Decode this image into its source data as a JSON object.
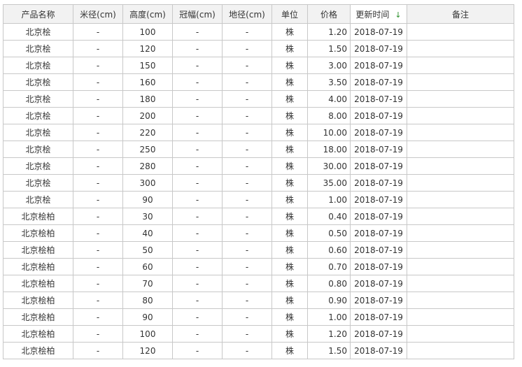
{
  "header": {
    "name": "产品名称",
    "diameter": "米径(cm)",
    "height": "高度(cm)",
    "crown": "冠幅(cm)",
    "ground": "地径(cm)",
    "unit": "单位",
    "price": "价格",
    "updated": "更新时间",
    "updated_arrow": "↓",
    "note": "备注"
  },
  "rows": [
    {
      "name": "北京桧",
      "diameter": "-",
      "height": "100",
      "crown": "-",
      "ground": "-",
      "unit": "株",
      "price": "1.20",
      "updated": "2018-07-19",
      "note": ""
    },
    {
      "name": "北京桧",
      "diameter": "-",
      "height": "120",
      "crown": "-",
      "ground": "-",
      "unit": "株",
      "price": "1.50",
      "updated": "2018-07-19",
      "note": ""
    },
    {
      "name": "北京桧",
      "diameter": "-",
      "height": "150",
      "crown": "-",
      "ground": "-",
      "unit": "株",
      "price": "3.00",
      "updated": "2018-07-19",
      "note": ""
    },
    {
      "name": "北京桧",
      "diameter": "-",
      "height": "160",
      "crown": "-",
      "ground": "-",
      "unit": "株",
      "price": "3.50",
      "updated": "2018-07-19",
      "note": ""
    },
    {
      "name": "北京桧",
      "diameter": "-",
      "height": "180",
      "crown": "-",
      "ground": "-",
      "unit": "株",
      "price": "4.00",
      "updated": "2018-07-19",
      "note": ""
    },
    {
      "name": "北京桧",
      "diameter": "-",
      "height": "200",
      "crown": "-",
      "ground": "-",
      "unit": "株",
      "price": "8.00",
      "updated": "2018-07-19",
      "note": ""
    },
    {
      "name": "北京桧",
      "diameter": "-",
      "height": "220",
      "crown": "-",
      "ground": "-",
      "unit": "株",
      "price": "10.00",
      "updated": "2018-07-19",
      "note": ""
    },
    {
      "name": "北京桧",
      "diameter": "-",
      "height": "250",
      "crown": "-",
      "ground": "-",
      "unit": "株",
      "price": "18.00",
      "updated": "2018-07-19",
      "note": ""
    },
    {
      "name": "北京桧",
      "diameter": "-",
      "height": "280",
      "crown": "-",
      "ground": "-",
      "unit": "株",
      "price": "30.00",
      "updated": "2018-07-19",
      "note": ""
    },
    {
      "name": "北京桧",
      "diameter": "-",
      "height": "300",
      "crown": "-",
      "ground": "-",
      "unit": "株",
      "price": "35.00",
      "updated": "2018-07-19",
      "note": ""
    },
    {
      "name": "北京桧",
      "diameter": "-",
      "height": "90",
      "crown": "-",
      "ground": "-",
      "unit": "株",
      "price": "1.00",
      "updated": "2018-07-19",
      "note": ""
    },
    {
      "name": "北京桧柏",
      "diameter": "-",
      "height": "30",
      "crown": "-",
      "ground": "-",
      "unit": "株",
      "price": "0.40",
      "updated": "2018-07-19",
      "note": ""
    },
    {
      "name": "北京桧柏",
      "diameter": "-",
      "height": "40",
      "crown": "-",
      "ground": "-",
      "unit": "株",
      "price": "0.50",
      "updated": "2018-07-19",
      "note": ""
    },
    {
      "name": "北京桧柏",
      "diameter": "-",
      "height": "50",
      "crown": "-",
      "ground": "-",
      "unit": "株",
      "price": "0.60",
      "updated": "2018-07-19",
      "note": ""
    },
    {
      "name": "北京桧柏",
      "diameter": "-",
      "height": "60",
      "crown": "-",
      "ground": "-",
      "unit": "株",
      "price": "0.70",
      "updated": "2018-07-19",
      "note": ""
    },
    {
      "name": "北京桧柏",
      "diameter": "-",
      "height": "70",
      "crown": "-",
      "ground": "-",
      "unit": "株",
      "price": "0.80",
      "updated": "2018-07-19",
      "note": ""
    },
    {
      "name": "北京桧柏",
      "diameter": "-",
      "height": "80",
      "crown": "-",
      "ground": "-",
      "unit": "株",
      "price": "0.90",
      "updated": "2018-07-19",
      "note": ""
    },
    {
      "name": "北京桧柏",
      "diameter": "-",
      "height": "90",
      "crown": "-",
      "ground": "-",
      "unit": "株",
      "price": "1.00",
      "updated": "2018-07-19",
      "note": ""
    },
    {
      "name": "北京桧柏",
      "diameter": "-",
      "height": "100",
      "crown": "-",
      "ground": "-",
      "unit": "株",
      "price": "1.20",
      "updated": "2018-07-19",
      "note": ""
    },
    {
      "name": "北京桧柏",
      "diameter": "-",
      "height": "120",
      "crown": "-",
      "ground": "-",
      "unit": "株",
      "price": "1.50",
      "updated": "2018-07-19",
      "note": ""
    }
  ],
  "colors": {
    "border": "#c8c8c8",
    "header_bg": "#f2f2f2",
    "sort_arrow": "#2a8f2a"
  },
  "icons": {
    "sort": "sort-down-icon"
  }
}
